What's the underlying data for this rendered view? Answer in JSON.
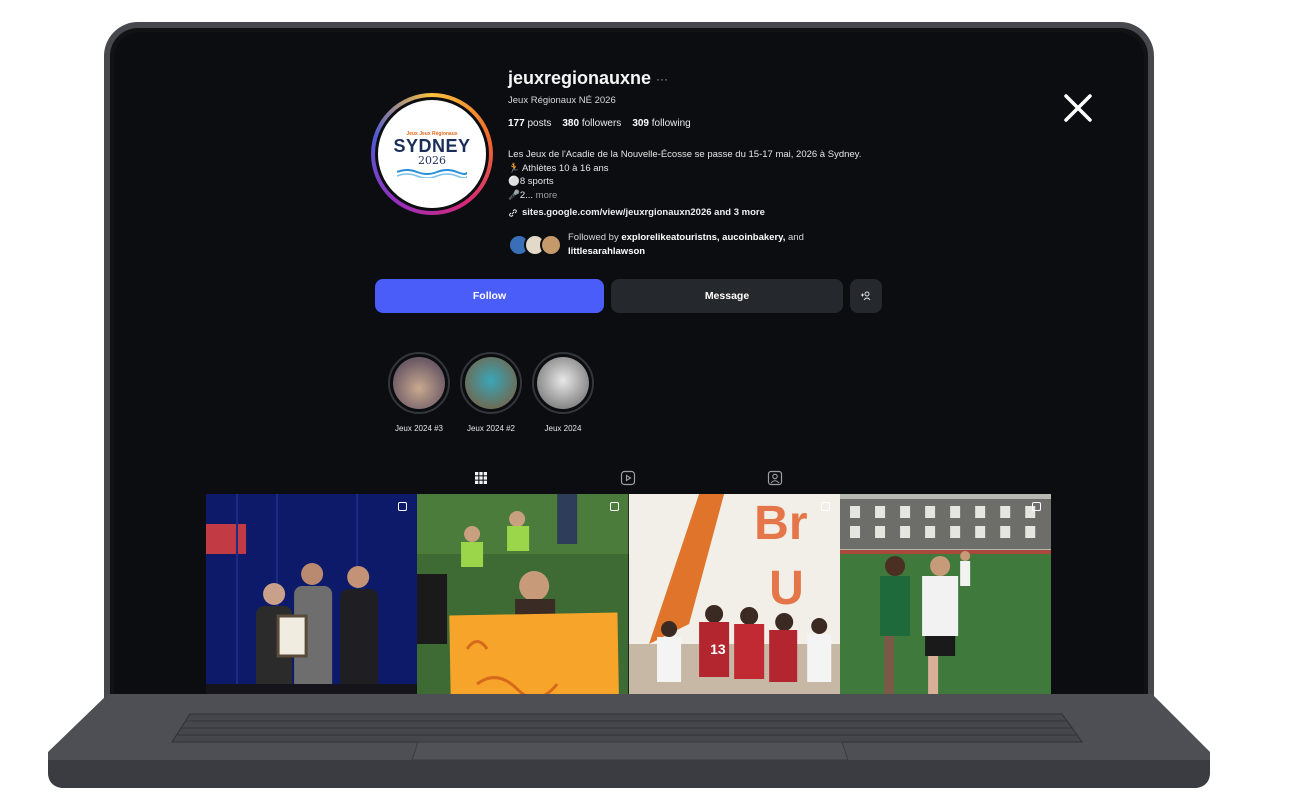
{
  "profile": {
    "username": "jeuxregionauxne",
    "options": "···",
    "full_name": "Jeux Régionaux NÉ 2026",
    "avatar": {
      "small": "Jeux Jeux Régionaux",
      "city": "SYDNEY",
      "year": "2026"
    },
    "stats": {
      "posts": "177",
      "posts_label": "posts",
      "followers": "380",
      "followers_label": "followers",
      "following": "309",
      "following_label": "following"
    },
    "bio": [
      "Les Jeux de l'Acadie de la Nouvelle-Écosse se passe du 15-17 mai, 2026 à Sydney.",
      "🏃 Athlètes 10 à 16 ans",
      "⚪8 sports",
      "🎤2..."
    ],
    "bio_more": "more",
    "link": "sites.google.com/view/jeuxrgionauxn2026 and 3 more",
    "followed_by_prefix": "Followed by",
    "followed_by_names": "explorelikeatouristns, aucoinbakery,",
    "followed_by_and": "and",
    "followed_by_last": "littlesarahlawson"
  },
  "actions": {
    "follow": "Follow",
    "message": "Message",
    "suggest": "+⁰"
  },
  "highlights": [
    {
      "label": "Jeux 2024 #3",
      "color": "#8a7a88"
    },
    {
      "label": "Jeux 2024 #2",
      "color": "#6c8c8c"
    },
    {
      "label": "Jeux 2024",
      "color": "#b5b5b5"
    }
  ],
  "tabs": [
    "posts",
    "reels",
    "tagged"
  ],
  "colors": {
    "accent": "#4a5df9",
    "background": "#0b0d10",
    "button": "#25282d"
  },
  "icons": [
    "close-icon",
    "link-icon",
    "grid-icon",
    "reels-icon",
    "tagged-icon",
    "carousel-icon"
  ]
}
